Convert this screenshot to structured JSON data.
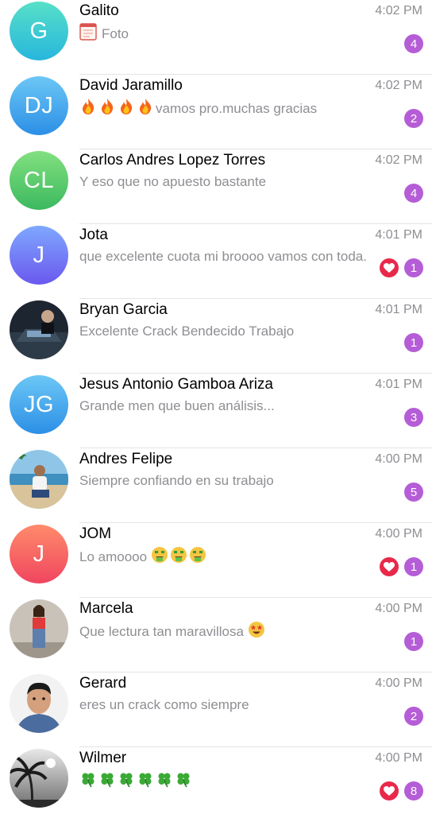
{
  "colors": {
    "badge": "#b55dd6",
    "heart": "#e8294a",
    "time": "#8e8e93",
    "preview": "#8e8e93"
  },
  "chats": [
    {
      "name": "Galito",
      "time": "4:02 PM",
      "preview": "Foto",
      "preview_icon": "photo-attachment-icon",
      "badge": "4",
      "initials": "G",
      "avatar_colors": [
        "#57e0c8",
        "#27b6dd"
      ]
    },
    {
      "name": "David Jaramillo",
      "time": "4:02 PM",
      "preview_emoji": [
        "fire",
        "fire",
        "fire",
        "fire"
      ],
      "preview": "vamos pro.muchas gracias",
      "badge": "2",
      "initials": "DJ",
      "avatar_colors": [
        "#6cc7f5",
        "#2c8fe6"
      ]
    },
    {
      "name": "Carlos Andres Lopez Torres",
      "time": "4:02 PM",
      "preview": "Y eso que no apuesto bastante",
      "badge": "4",
      "initials": "CL",
      "avatar_colors": [
        "#82e07f",
        "#3cb95f"
      ]
    },
    {
      "name": "Jota",
      "time": "4:01 PM",
      "preview": "que excelente cuota mi broooo vamos con toda.",
      "badge": "1",
      "heart": true,
      "initials": "J",
      "avatar_colors": [
        "#7fa8ff",
        "#6a58ee"
      ]
    },
    {
      "name": "Bryan Garcia",
      "time": "4:01 PM",
      "preview": "Excelente Crack Bendecido Trabajo",
      "badge": "1",
      "avatar_photo": "dark-car-photo"
    },
    {
      "name": "Jesus Antonio Gamboa Ariza",
      "time": "4:01 PM",
      "preview": "Grande men que buen análisis...",
      "badge": "3",
      "initials": "JG",
      "avatar_colors": [
        "#6cc7f5",
        "#2c8fe6"
      ]
    },
    {
      "name": "Andres Felipe",
      "time": "4:00 PM",
      "preview": "Siempre confiando en su trabajo",
      "badge": "5",
      "avatar_photo": "beach-person-photo"
    },
    {
      "name": "JOM",
      "time": "4:00 PM",
      "preview": "Lo amoooo",
      "preview_emoji_after": [
        "money-mouth",
        "money-mouth",
        "money-mouth"
      ],
      "badge": "1",
      "heart": true,
      "initials": "J",
      "avatar_colors": [
        "#ff8b6b",
        "#f0455f"
      ]
    },
    {
      "name": "Marcela",
      "time": "4:00 PM",
      "preview": "Que lectura tan maravillosa",
      "preview_emoji_after": [
        "star-struck"
      ],
      "badge": "1",
      "avatar_photo": "woman-standing-photo"
    },
    {
      "name": "Gerard",
      "time": "4:00 PM",
      "preview": "eres un crack como siempre",
      "badge": "2",
      "avatar_photo": "man-portrait-photo"
    },
    {
      "name": "Wilmer",
      "time": "4:00 PM",
      "preview": "",
      "preview_emoji": [
        "four-leaf-clover",
        "four-leaf-clover",
        "four-leaf-clover",
        "four-leaf-clover",
        "four-leaf-clover",
        "four-leaf-clover"
      ],
      "badge": "8",
      "heart": true,
      "avatar_photo": "palm-tree-photo"
    }
  ]
}
